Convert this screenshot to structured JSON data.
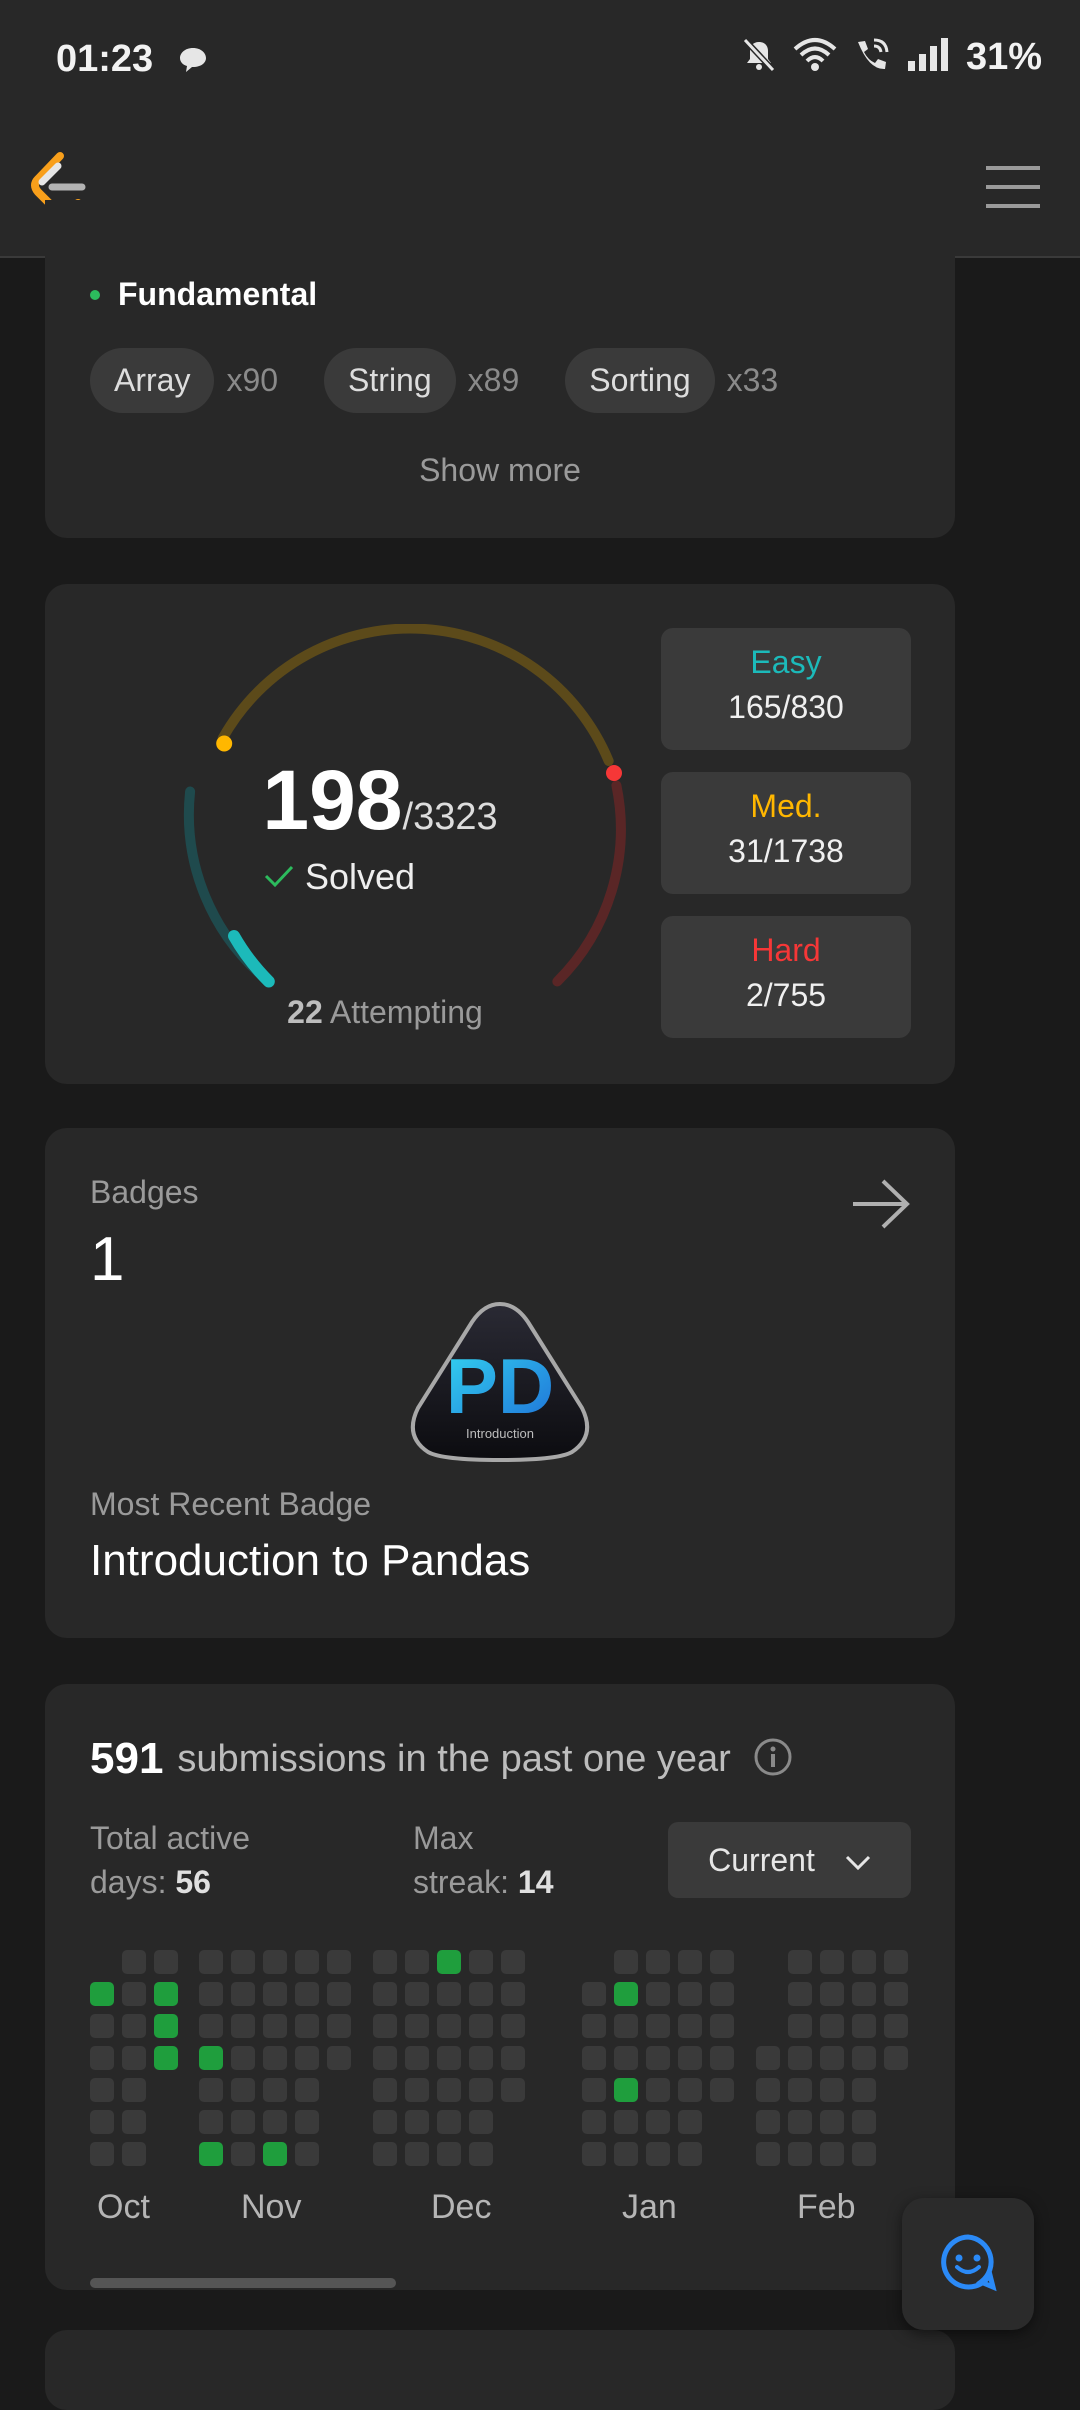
{
  "status_bar": {
    "time": "01:23",
    "battery": "31%"
  },
  "colors": {
    "easy": "#1cbaba",
    "medium": "#ffb700",
    "hard": "#f63737",
    "activity": "#1f9e3d",
    "accent": "#2cbb5d"
  },
  "skills": {
    "heading": "Fundamental",
    "tags": [
      {
        "name": "Array",
        "count": "x90"
      },
      {
        "name": "String",
        "count": "x89"
      },
      {
        "name": "Sorting",
        "count": "x33"
      }
    ],
    "show_more": "Show more"
  },
  "progress": {
    "solved": "198",
    "total": "/3323",
    "solved_label": "Solved",
    "attempting_count": "22",
    "attempting_label": "Attempting",
    "difficulties": [
      {
        "name": "Easy",
        "value": "165/830"
      },
      {
        "name": "Med.",
        "value": "31/1738"
      },
      {
        "name": "Hard",
        "value": "2/755"
      }
    ]
  },
  "badges": {
    "label": "Badges",
    "count": "1",
    "badge_letters": "PD",
    "badge_caption": "Introduction",
    "recent_label": "Most Recent Badge",
    "recent_name": "Introduction to Pandas"
  },
  "submissions": {
    "count": "591",
    "text": "submissions in the past one year",
    "active_days_label_1": "Total active",
    "active_days_label_2": "days:",
    "active_days": "56",
    "max_streak_label_1": "Max",
    "max_streak_label_2": "streak:",
    "max_streak": "14",
    "range": "Current",
    "months": [
      "Oct",
      "Nov",
      "Dec",
      "Jan",
      "Feb"
    ]
  },
  "icons": {
    "status": [
      "chat-bubble-icon",
      "mute-icon",
      "wifi-icon",
      "call-icon",
      "signal-icon"
    ],
    "nav": [
      "leetcode-logo",
      "hamburger-menu-icon"
    ],
    "other": [
      "check-icon",
      "arrow-right-icon",
      "info-icon",
      "chevron-down-icon",
      "chat-smile-icon"
    ]
  }
}
